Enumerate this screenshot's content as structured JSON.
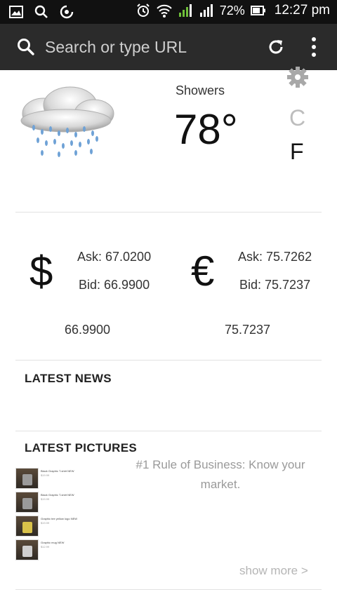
{
  "status_bar": {
    "battery_percent": "72%",
    "time": "12:27 pm"
  },
  "browser": {
    "url_placeholder": "Search or type URL"
  },
  "weather": {
    "condition": "Showers",
    "temperature": "78°",
    "unit_c": "C",
    "unit_f": "F",
    "selected_unit": "F"
  },
  "currency": {
    "usd": {
      "symbol": "$",
      "ask": "Ask: 67.0200",
      "bid": "Bid: 66.9900",
      "value": "66.9900"
    },
    "eur": {
      "symbol": "€",
      "ask": "Ask: 75.7262",
      "bid": "Bid: 75.7237",
      "value": "75.7237"
    }
  },
  "news": {
    "title": "LATEST NEWS"
  },
  "pictures": {
    "title": "LATEST PICTURES",
    "quote": "#1 Rule of Business: Know your market.",
    "show_more": "show more >",
    "items": [
      {
        "caption": "Black Graphic T-shirt NEW",
        "price": "$19.99"
      },
      {
        "caption": "Black Graphic T-shirt NEW",
        "price": "$19.99"
      },
      {
        "caption": "Graphic tee yellow logo NEW",
        "price": "$19.99"
      },
      {
        "caption": "Graphic mug NEW",
        "price": "$12.99"
      }
    ]
  },
  "colors": {
    "toolbar_bg": "#2b2b2b",
    "status_bg": "#111111",
    "muted_text": "#9a9a9a"
  }
}
